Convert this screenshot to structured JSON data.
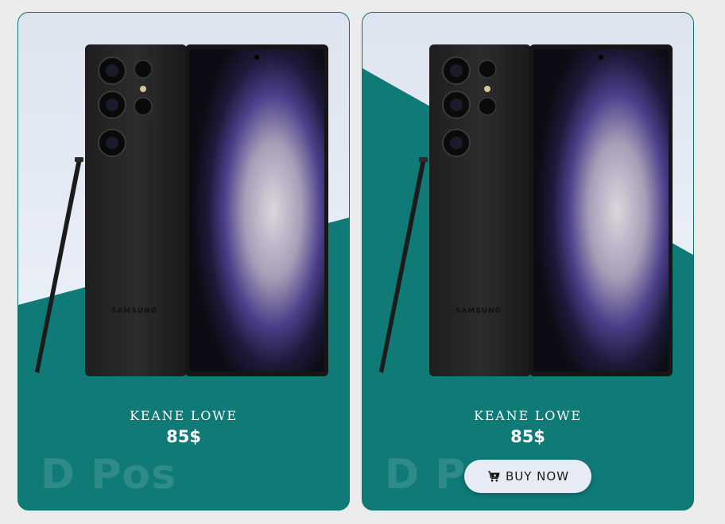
{
  "cards": [
    {
      "name": "KEANE LOWE",
      "price": "85$",
      "watermark": "D Pos",
      "brand_on_phone": "SAMSUNG"
    },
    {
      "name": "KEANE LOWE",
      "price": "85$",
      "watermark": "D Pos",
      "brand_on_phone": "SAMSUNG",
      "button_label": "BUY NOW",
      "button_icon": "cart-plus-icon"
    }
  ],
  "colors": {
    "page_bg": "#ececec",
    "card_teal": "#0f7a76",
    "card_light": "#e3e9f4",
    "button_bg": "#e7ebf5"
  }
}
